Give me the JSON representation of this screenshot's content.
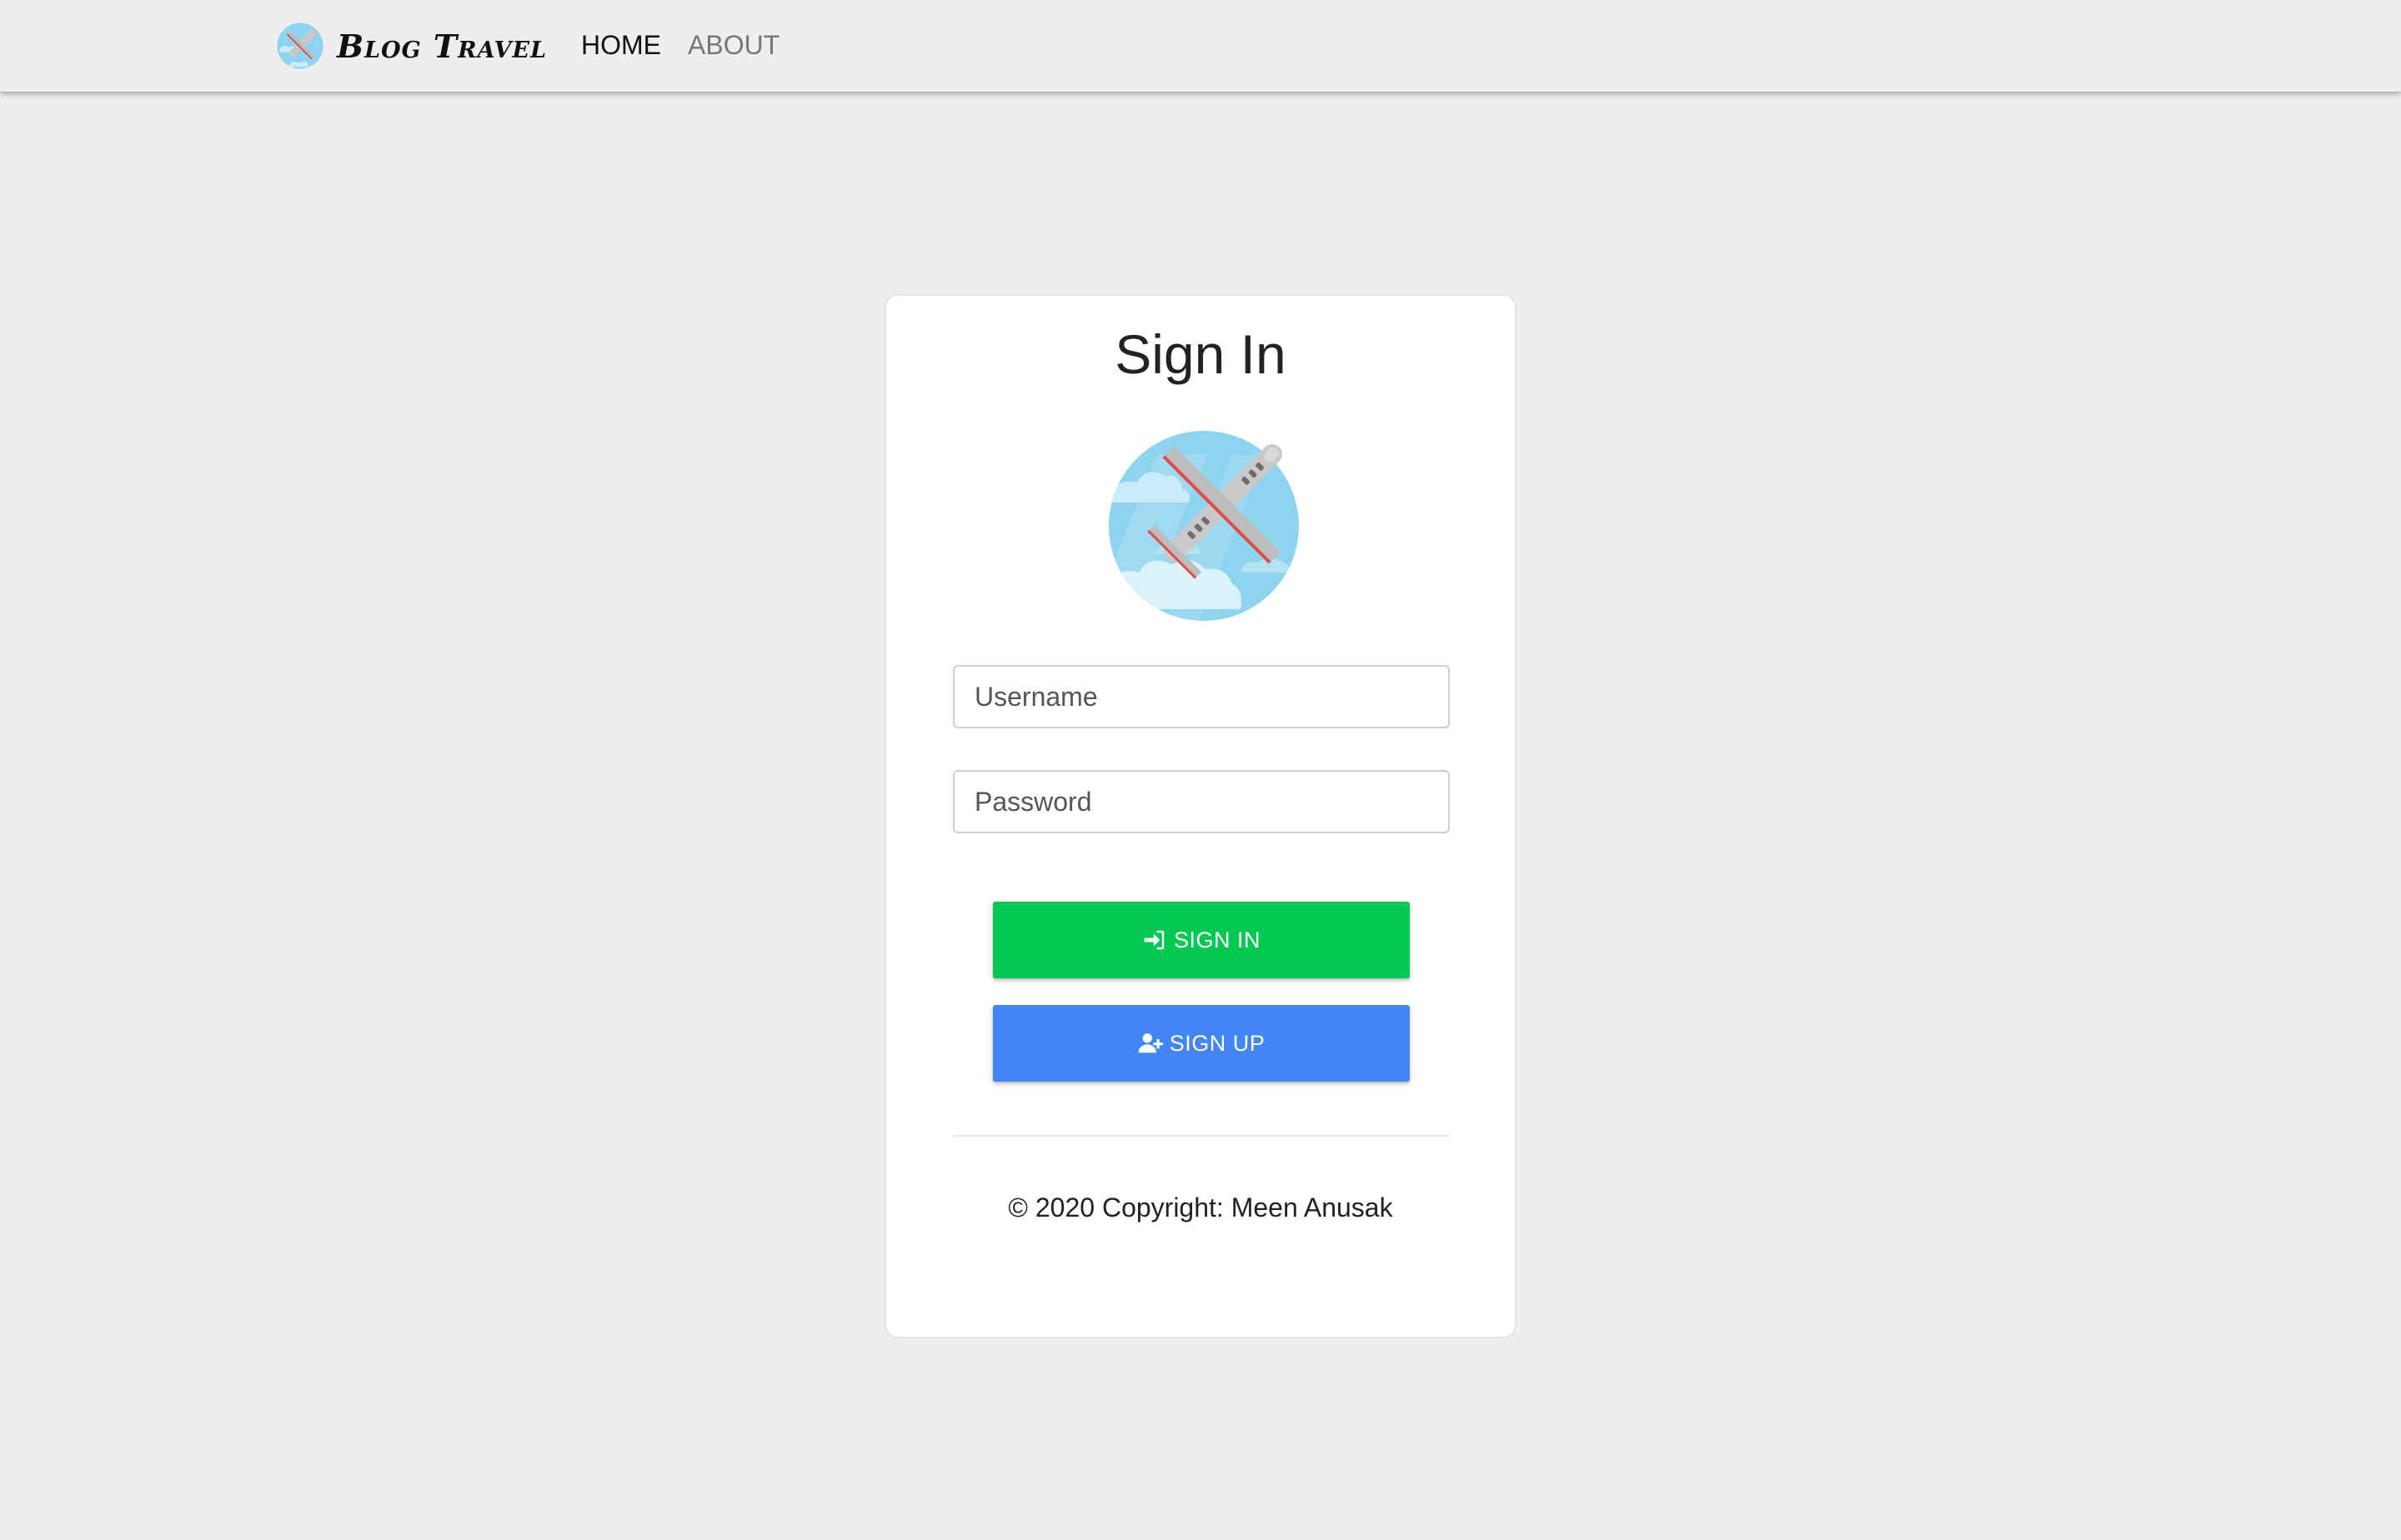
{
  "navbar": {
    "brand_name": "Blog Travel",
    "brand_logo_icon": "airplane-globe-icon",
    "links": [
      {
        "label": "HOME",
        "active": true
      },
      {
        "label": "ABOUT",
        "active": false
      }
    ]
  },
  "card": {
    "title": "Sign In",
    "hero_icon": "airplane-sky-icon",
    "username": {
      "placeholder": "Username",
      "value": ""
    },
    "password": {
      "placeholder": "Password",
      "value": ""
    },
    "signin_button": {
      "label": "SIGN IN",
      "icon": "sign-in-icon"
    },
    "signup_button": {
      "label": "SIGN UP",
      "icon": "user-plus-icon"
    },
    "copyright": "© 2020 Copyright: Meen Anusak"
  },
  "colors": {
    "background": "#eeeeee",
    "card": "#ffffff",
    "signin": "#00c851",
    "signup": "#4285f4",
    "sky": "#8fd4ef"
  }
}
